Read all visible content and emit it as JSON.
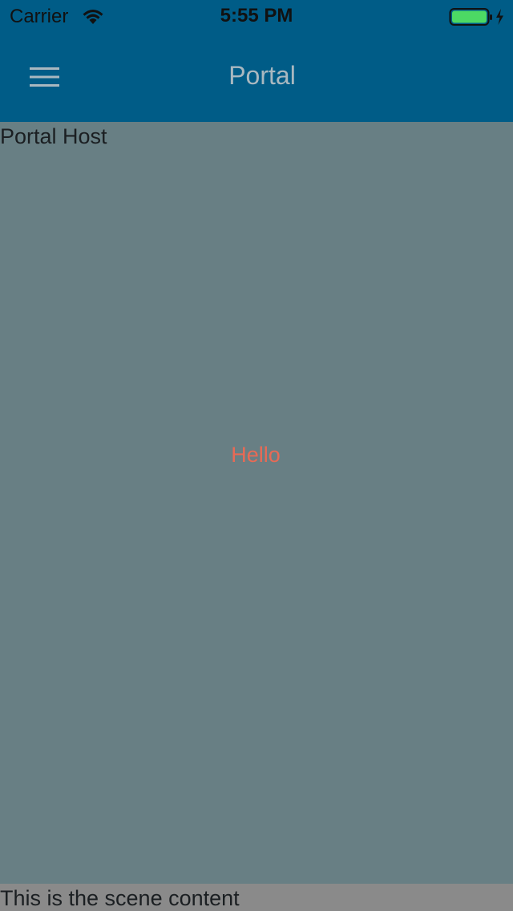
{
  "status_bar": {
    "carrier": "Carrier",
    "time": "5:55 PM",
    "battery_color": "#4cd964"
  },
  "nav_bar": {
    "title": "Portal",
    "menu_icon": "hamburger-menu-icon",
    "background": "#005c87"
  },
  "portal_host": {
    "label": "Portal Host",
    "message": "Hello",
    "background": "#687f84",
    "message_color": "#e86a55"
  },
  "scene": {
    "label": "This is the scene content"
  }
}
